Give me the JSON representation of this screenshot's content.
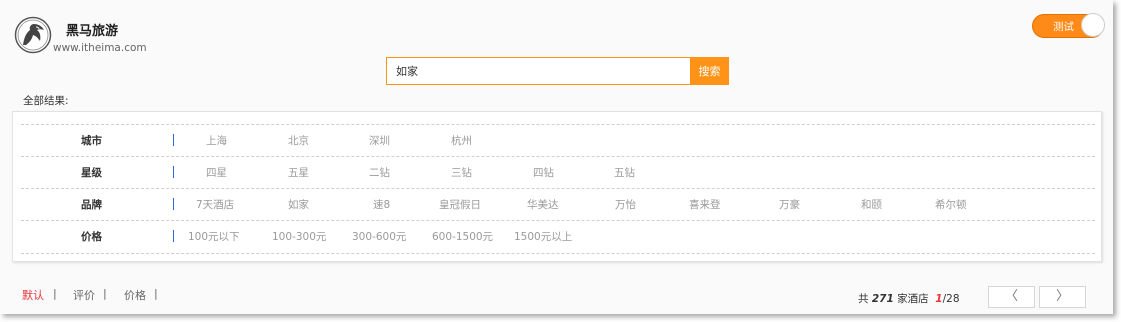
{
  "header": {
    "brand_name": "黑马旅游",
    "brand_url": "www.itheima.com",
    "logo_icon": "horse-logo-icon"
  },
  "toggle": {
    "label": "测试",
    "state": "on",
    "color": "#ff8a18"
  },
  "search": {
    "value": "如家",
    "placeholder": "",
    "button_label": "搜索",
    "accent": "#ff9318"
  },
  "results_label": "全部结果:",
  "filters": {
    "rows": [
      {
        "label": "城市",
        "options": [
          "上海",
          "北京",
          "深圳",
          "杭州"
        ]
      },
      {
        "label": "星级",
        "options": [
          "四星",
          "五星",
          "二钻",
          "三钻",
          "四钻",
          "五钻"
        ]
      },
      {
        "label": "品牌",
        "options": [
          "7天酒店",
          "如家",
          "速8",
          "皇冠假日",
          "华美达",
          "万怡",
          "喜来登",
          "万豪",
          "和颐",
          "希尔顿"
        ]
      },
      {
        "label": "价格",
        "options": [
          "100元以下",
          "100-300元",
          "300-600元",
          "600-1500元",
          "1500元以上"
        ]
      }
    ]
  },
  "sort": {
    "items": [
      {
        "label": "默认",
        "active": true
      },
      {
        "label": "评价",
        "active": false
      },
      {
        "label": "价格",
        "active": false
      }
    ],
    "separator": "|"
  },
  "pagination": {
    "prefix": "共",
    "total_count": "271",
    "suffix": "家酒店",
    "current_page": "1",
    "total_pages": "/28",
    "prev_icon": "chevron-left-icon",
    "next_icon": "chevron-right-icon",
    "prev_glyph": "〈",
    "next_glyph": "〉"
  },
  "colors": {
    "accent": "#ff9318",
    "active_red": "#e8343b",
    "divider_blue": "#2b6fd6"
  }
}
